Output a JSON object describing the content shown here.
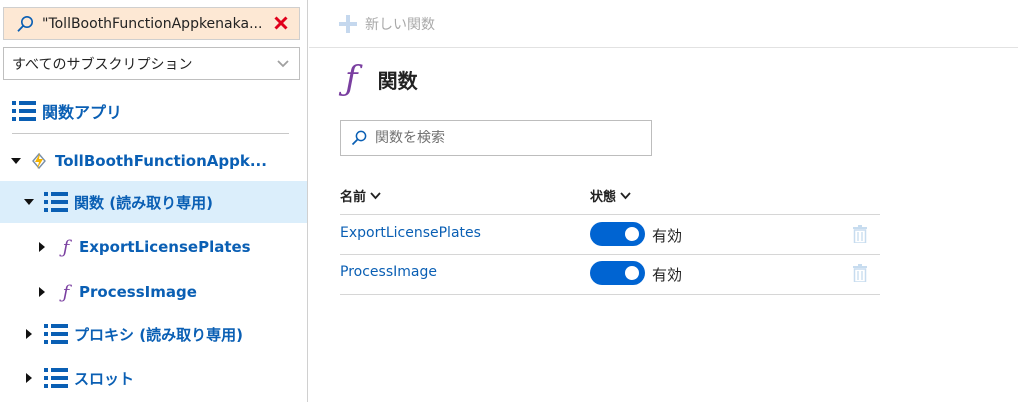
{
  "sidebar": {
    "search_value": "\"TollBoothFunctionAppkenaka...",
    "subscription_selected": "すべてのサブスクリプション",
    "section_title": "関数アプリ",
    "tree": {
      "app": "TollBoothFunctionAppk...",
      "functions_node": "関数 (読み取り専用)",
      "function_items": [
        "ExportLicensePlates",
        "ProcessImage"
      ],
      "proxies_node": "プロキシ (読み取り専用)",
      "slots_node": "スロット"
    }
  },
  "toolbar": {
    "new_function_label": "新しい関数"
  },
  "main": {
    "title": "関数",
    "search_placeholder": "関数を検索",
    "columns": {
      "name": "名前",
      "status": "状態"
    },
    "rows": [
      {
        "name": "ExportLicensePlates",
        "status": "有効",
        "enabled": true
      },
      {
        "name": "ProcessImage",
        "status": "有効",
        "enabled": true
      }
    ]
  },
  "colors": {
    "accent": "#0064d2",
    "link": "#0a5fb4",
    "function_purple": "#7a3fa0",
    "selected_bg": "#dbeefb",
    "search_bg": "#fde8d4",
    "clear_red": "#e0001b"
  },
  "icons": [
    "search-icon",
    "clear-icon",
    "chevron-down-icon",
    "list-icon",
    "lightning-icon",
    "function-icon",
    "plus-icon",
    "trash-icon"
  ]
}
